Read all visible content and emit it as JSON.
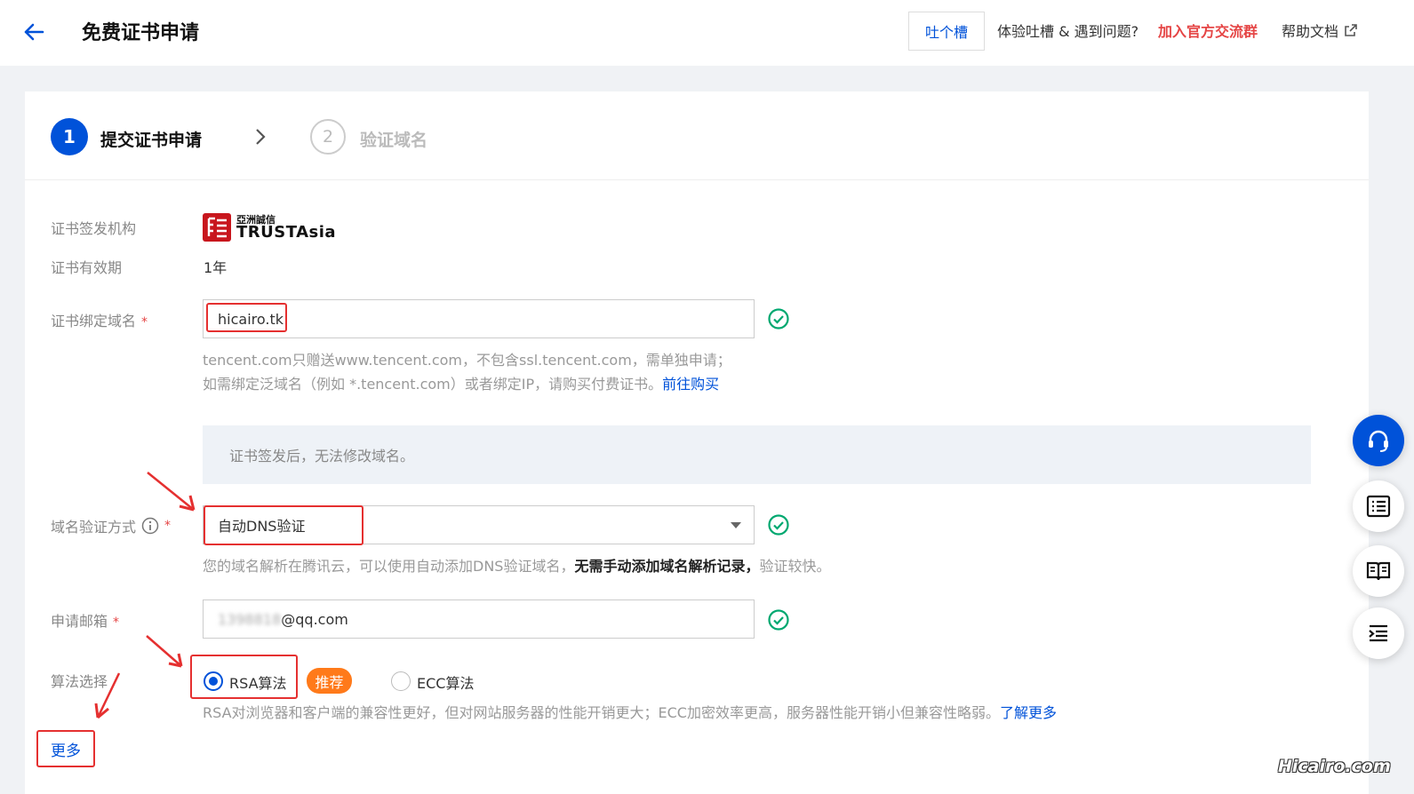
{
  "header": {
    "title": "免费证书申请",
    "feedback_label": "吐个槽",
    "feedback_prompt": "体验吐槽 & 遇到问题?",
    "join_group_link": "加入官方交流群",
    "help_doc_link": "帮助文档"
  },
  "steps": [
    {
      "number": "1",
      "label": "提交证书申请",
      "status": "active"
    },
    {
      "number": "2",
      "label": "验证域名",
      "status": "pending"
    }
  ],
  "form": {
    "issuer": {
      "label": "证书签发机构",
      "logo_text_cn": "亞洲誠信",
      "logo_text_en": "TRUSTAsia"
    },
    "validity": {
      "label": "证书有效期",
      "value": "1年"
    },
    "domain": {
      "label": "证书绑定域名",
      "required_mark": "*",
      "value": "hicairo.tk",
      "hint_line1": "tencent.com只赠送www.tencent.com，不包含ssl.tencent.com，需单独申请；",
      "hint_line2": "如需绑定泛域名（例如 *.tencent.com）或者绑定IP，请购买付费证书。",
      "hint_link": "前往购买"
    },
    "notice": "证书签发后，无法修改域名。",
    "verify_method": {
      "label": "域名验证方式",
      "required_mark": "*",
      "value": "自动DNS验证",
      "hint_prefix": "您的域名解析在腾讯云，可以使用自动添加DNS验证域名，",
      "hint_bold": "无需手动添加域名解析记录，",
      "hint_suffix": "验证较快。"
    },
    "email": {
      "label": "申请邮箱",
      "required_mark": "*",
      "masked_part": "1398818",
      "domain_part": "@qq.com"
    },
    "algorithm": {
      "label": "算法选择",
      "options": [
        {
          "label": "RSA算法",
          "selected": true
        },
        {
          "label": "ECC算法",
          "selected": false
        }
      ],
      "badge": "推荐",
      "hint": "RSA对浏览器和客户端的兼容性更好，但对网站服务器的性能开销更大；ECC加密效率更高，服务器性能开销小但兼容性略弱。",
      "hint_link": "了解更多"
    },
    "more_label": "更多"
  },
  "watermark": "Hicairo.com",
  "colors": {
    "primary": "#0052d9",
    "danger": "#e54545",
    "success": "#00a870",
    "badge": "#ff7a1a"
  }
}
